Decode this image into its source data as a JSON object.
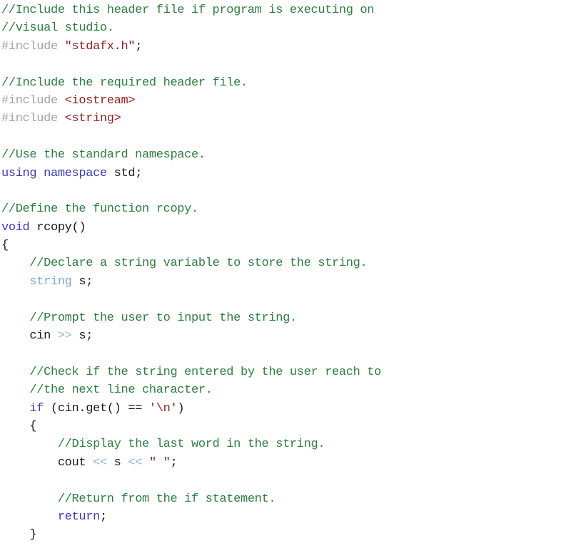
{
  "document": {
    "kind": "source-code-listing",
    "language": "C++",
    "background_color": "#ffffff"
  },
  "theme": {
    "comment_color": "#2e7d3f",
    "preprocessor_color": "#a3a3a3",
    "string_color": "#8c2323",
    "keyword_color": "#3b3bb0",
    "type_color": "#7fabcc",
    "operator_color": "#8bb6d0",
    "plain_color": "#1a1a1a"
  },
  "code": {
    "lines": [
      {
        "indent": 0,
        "tokens": [
          {
            "t": "comment",
            "s": "//Include this header file if program is executing on"
          }
        ]
      },
      {
        "indent": 0,
        "tokens": [
          {
            "t": "comment",
            "s": "//visual studio."
          }
        ]
      },
      {
        "indent": 0,
        "tokens": [
          {
            "t": "pre",
            "s": "#include "
          },
          {
            "t": "string",
            "s": "\"stdafx.h\""
          },
          {
            "t": "punct",
            "s": ";"
          }
        ]
      },
      {
        "indent": 0,
        "tokens": []
      },
      {
        "indent": 0,
        "tokens": [
          {
            "t": "comment",
            "s": "//Include the required header file."
          }
        ]
      },
      {
        "indent": 0,
        "tokens": [
          {
            "t": "pre",
            "s": "#include "
          },
          {
            "t": "string",
            "s": "<iostream>"
          }
        ]
      },
      {
        "indent": 0,
        "tokens": [
          {
            "t": "pre",
            "s": "#include "
          },
          {
            "t": "string",
            "s": "<string>"
          }
        ]
      },
      {
        "indent": 0,
        "tokens": []
      },
      {
        "indent": 0,
        "tokens": [
          {
            "t": "comment",
            "s": "//Use the standard namespace."
          }
        ]
      },
      {
        "indent": 0,
        "tokens": [
          {
            "t": "keyword",
            "s": "using namespace"
          },
          {
            "t": "plain",
            "s": " std;"
          }
        ]
      },
      {
        "indent": 0,
        "tokens": []
      },
      {
        "indent": 0,
        "tokens": [
          {
            "t": "comment",
            "s": "//Define the function rcopy."
          }
        ]
      },
      {
        "indent": 0,
        "tokens": [
          {
            "t": "keyword",
            "s": "void"
          },
          {
            "t": "plain",
            "s": " rcopy()"
          }
        ]
      },
      {
        "indent": 0,
        "tokens": [
          {
            "t": "plain",
            "s": "{"
          }
        ]
      },
      {
        "indent": 1,
        "tokens": [
          {
            "t": "comment",
            "s": "//Declare a string variable to store the string."
          }
        ]
      },
      {
        "indent": 1,
        "tokens": [
          {
            "t": "type",
            "s": "string"
          },
          {
            "t": "plain",
            "s": " s;"
          }
        ]
      },
      {
        "indent": 0,
        "tokens": []
      },
      {
        "indent": 1,
        "tokens": [
          {
            "t": "comment",
            "s": "//Prompt the user to input the string."
          }
        ]
      },
      {
        "indent": 1,
        "tokens": [
          {
            "t": "plain",
            "s": "cin "
          },
          {
            "t": "operator",
            "s": ">>"
          },
          {
            "t": "plain",
            "s": " s;"
          }
        ]
      },
      {
        "indent": 0,
        "tokens": []
      },
      {
        "indent": 1,
        "tokens": [
          {
            "t": "comment",
            "s": "//Check if the string entered by the user reach to"
          }
        ]
      },
      {
        "indent": 1,
        "tokens": [
          {
            "t": "comment",
            "s": "//the next line character."
          }
        ]
      },
      {
        "indent": 1,
        "tokens": [
          {
            "t": "keyword",
            "s": "if"
          },
          {
            "t": "plain",
            "s": " (cin.get() == "
          },
          {
            "t": "string",
            "s": "'\\n'"
          },
          {
            "t": "plain",
            "s": ")"
          }
        ]
      },
      {
        "indent": 1,
        "tokens": [
          {
            "t": "plain",
            "s": "{"
          }
        ]
      },
      {
        "indent": 2,
        "tokens": [
          {
            "t": "comment",
            "s": "//Display the last word in the string."
          }
        ]
      },
      {
        "indent": 2,
        "tokens": [
          {
            "t": "plain",
            "s": "cout "
          },
          {
            "t": "operator",
            "s": "<<"
          },
          {
            "t": "plain",
            "s": " s "
          },
          {
            "t": "operator",
            "s": "<<"
          },
          {
            "t": "plain",
            "s": " "
          },
          {
            "t": "string",
            "s": "\" \""
          },
          {
            "t": "punct",
            "s": ";"
          }
        ]
      },
      {
        "indent": 0,
        "tokens": []
      },
      {
        "indent": 2,
        "tokens": [
          {
            "t": "comment",
            "s": "//Return from the if statement."
          }
        ]
      },
      {
        "indent": 2,
        "tokens": [
          {
            "t": "keyword",
            "s": "return"
          },
          {
            "t": "punct",
            "s": ";"
          }
        ]
      },
      {
        "indent": 1,
        "tokens": [
          {
            "t": "plain",
            "s": "}"
          }
        ]
      }
    ]
  }
}
